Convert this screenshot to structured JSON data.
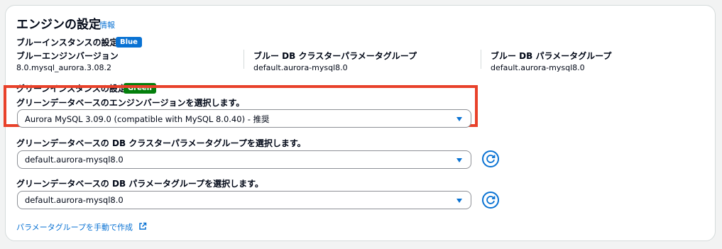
{
  "panel": {
    "title": "エンジンの設定",
    "info_link": "情報"
  },
  "blue": {
    "heading": "ブルーインスタンスの設定",
    "badge": "Blue",
    "badge_color": "#0972d3",
    "columns": [
      {
        "label": "ブルーエンジンバージョン",
        "value": "8.0.mysql_aurora.3.08.2"
      },
      {
        "label": "ブルー DB クラスターパラメータグループ",
        "value": "default.aurora-mysql8.0"
      },
      {
        "label": "ブルー DB パラメータグループ",
        "value": "default.aurora-mysql8.0"
      }
    ]
  },
  "green": {
    "heading": "グリーンインスタンスの設定",
    "badge": "Green",
    "badge_color": "#037f0c",
    "engine_version": {
      "label": "グリーンデータベースのエンジンバージョンを選択します。",
      "selected": "Aurora MySQL 3.09.0 (compatible with MySQL 8.0.40) - 推奨"
    },
    "cluster_param_group": {
      "label": "グリーンデータベースの DB クラスターパラメータグループを選択します。",
      "selected": "default.aurora-mysql8.0"
    },
    "db_param_group": {
      "label": "グリーンデータベースの DB パラメータグループを選択します。",
      "selected": "default.aurora-mysql8.0"
    },
    "manual_create_link": "パラメータグループを手動で作成"
  },
  "icons": {
    "caret": "caret-down-icon",
    "refresh": "refresh-icon",
    "external": "external-link-icon"
  },
  "highlight_color": "#e8412a"
}
